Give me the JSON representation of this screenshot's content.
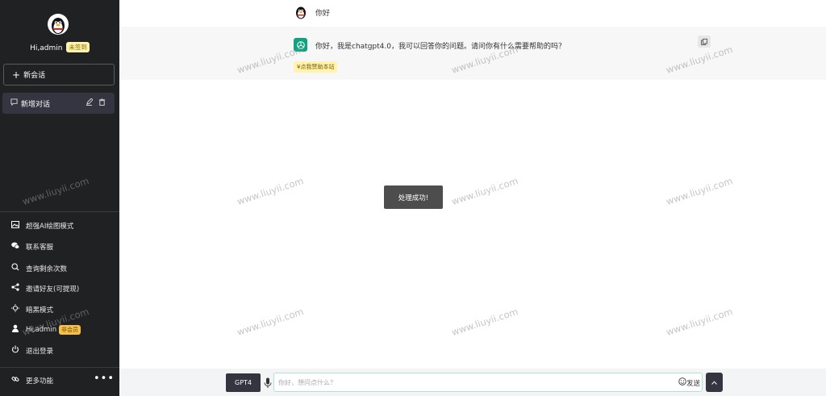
{
  "sidebar": {
    "user_greeting": "Hi,admin",
    "unsigned_badge": "未签到",
    "new_chat_label": "新会话",
    "conversation": {
      "label": "新增对话"
    },
    "menu": [
      {
        "icon": "image-icon",
        "label": "超强AI绘图模式"
      },
      {
        "icon": "wechat-icon",
        "label": "联系客服"
      },
      {
        "icon": "search-icon",
        "label": "查询剩余次数"
      },
      {
        "icon": "share-icon",
        "label": "邀请好友(可提现)"
      },
      {
        "icon": "sun-icon",
        "label": "暗黑模式"
      },
      {
        "icon": "user-icon",
        "label": "Hi,admin",
        "badge": "非会员"
      },
      {
        "icon": "power-icon",
        "label": "退出登录"
      }
    ],
    "more_label": "更多功能"
  },
  "chat": {
    "user_message": "你好",
    "bot_message": "你好，我是chatgpt4.0，我可以回答你的问题。请问你有什么需要帮助的吗？",
    "sponsor_label": "¥点我赞助本站"
  },
  "toast": "处理成功!",
  "watermark": "www.liuyii.com",
  "input": {
    "model_label": "GPT4",
    "placeholder": "你好，想问点什么？",
    "send_label": "发送"
  },
  "colors": {
    "sidebar_bg": "#202123",
    "accent_green": "#10a37f",
    "badge_yellow": "#fff3b0",
    "member_badge": "#f5c14b"
  }
}
